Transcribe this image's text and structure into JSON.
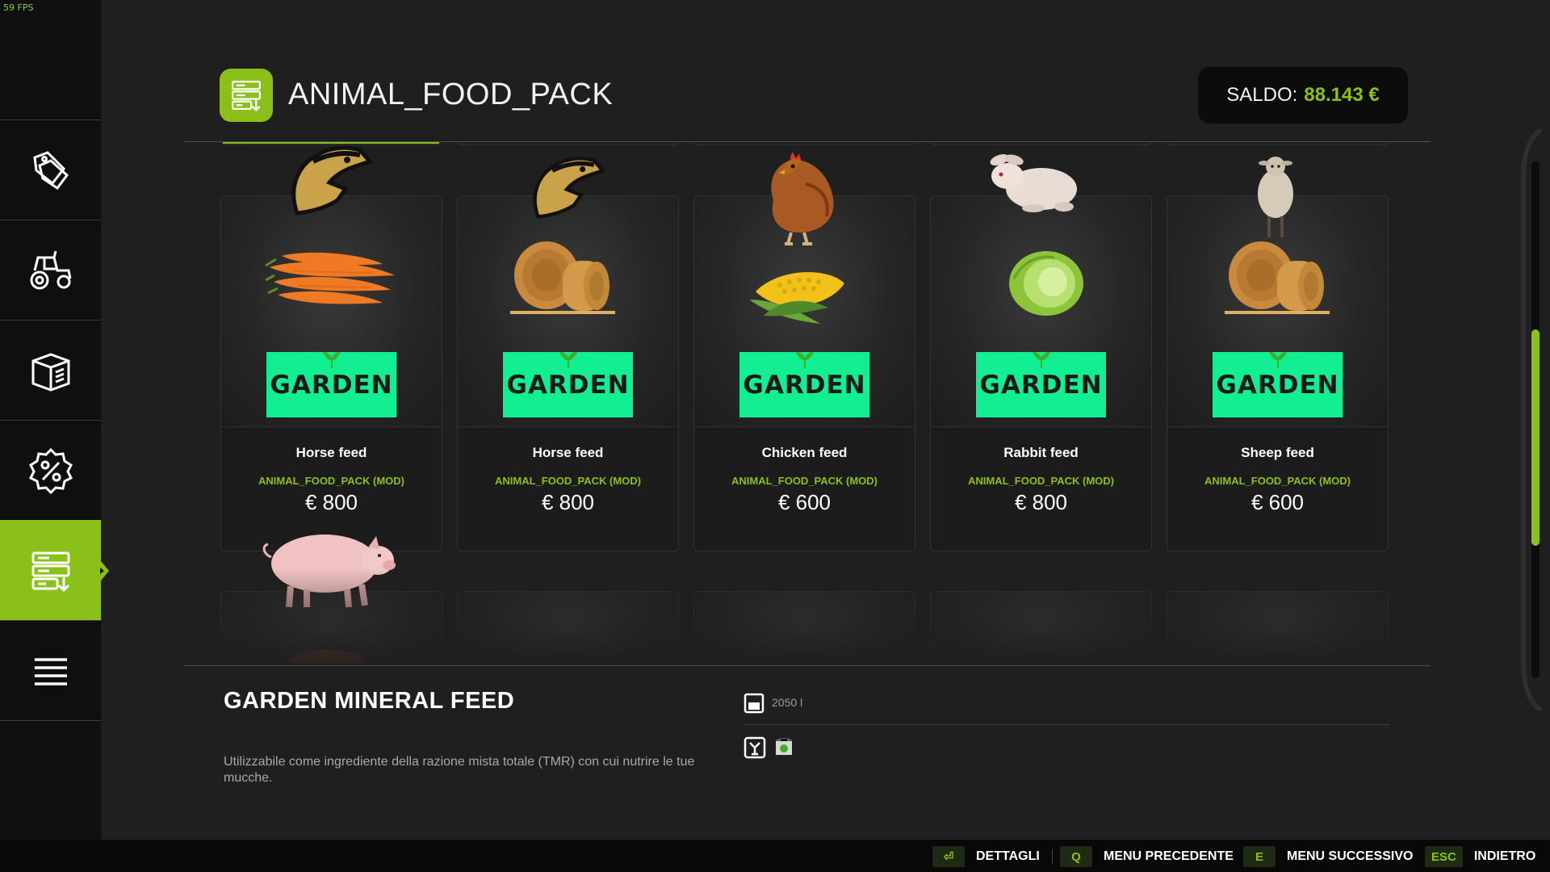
{
  "fps": "59 FPS",
  "header": {
    "title": "ANIMAL_FOOD_PACK",
    "saldo_label": "SALDO:",
    "saldo_value": "88.143 €"
  },
  "sidebar": {
    "items": [
      {
        "icon": "price-tag-icon"
      },
      {
        "icon": "tractor-icon"
      },
      {
        "icon": "box-icon"
      },
      {
        "icon": "percent-icon"
      },
      {
        "icon": "shelf-download-icon",
        "active": true
      },
      {
        "icon": "list-icon"
      }
    ]
  },
  "products": [
    {
      "name": "Horse feed",
      "source": "ANIMAL_FOOD_PACK (MOD)",
      "price": "€ 800",
      "logo": "GARDEN",
      "animal": "horse-logo",
      "food": "carrots"
    },
    {
      "name": "Horse feed",
      "source": "ANIMAL_FOOD_PACK (MOD)",
      "price": "€ 800",
      "logo": "GARDEN",
      "animal": "horse-logo",
      "food": "hay-bales"
    },
    {
      "name": "Chicken feed",
      "source": "ANIMAL_FOOD_PACK (MOD)",
      "price": "€ 600",
      "logo": "GARDEN",
      "animal": "chicken",
      "food": "corn"
    },
    {
      "name": "Rabbit feed",
      "source": "ANIMAL_FOOD_PACK (MOD)",
      "price": "€ 800",
      "logo": "GARDEN",
      "animal": "rabbit",
      "food": "cabbage"
    },
    {
      "name": "Sheep feed",
      "source": "ANIMAL_FOOD_PACK (MOD)",
      "price": "€ 600",
      "logo": "GARDEN",
      "animal": "sheep",
      "food": "hay-bales"
    }
  ],
  "details": {
    "title": "GARDEN MINERAL FEED",
    "description": "Utilizzabile come ingrediente della razione mista totale (TMR) con cui nutrire le tue mucche.",
    "capacity": "2050 l"
  },
  "keybinds": [
    {
      "key": "⏎",
      "label": "DETTAGLI"
    },
    {
      "key": "Q",
      "label": "MENU PRECEDENTE"
    },
    {
      "key": "E",
      "label": "MENU SUCCESSIVO"
    },
    {
      "key": "ESC",
      "label": "INDIETRO"
    }
  ],
  "colors": {
    "accent": "#8bbf1a",
    "logo_bg": "#12ee92",
    "background": "#1f1f1f",
    "sidebar": "#0f0f0f"
  }
}
